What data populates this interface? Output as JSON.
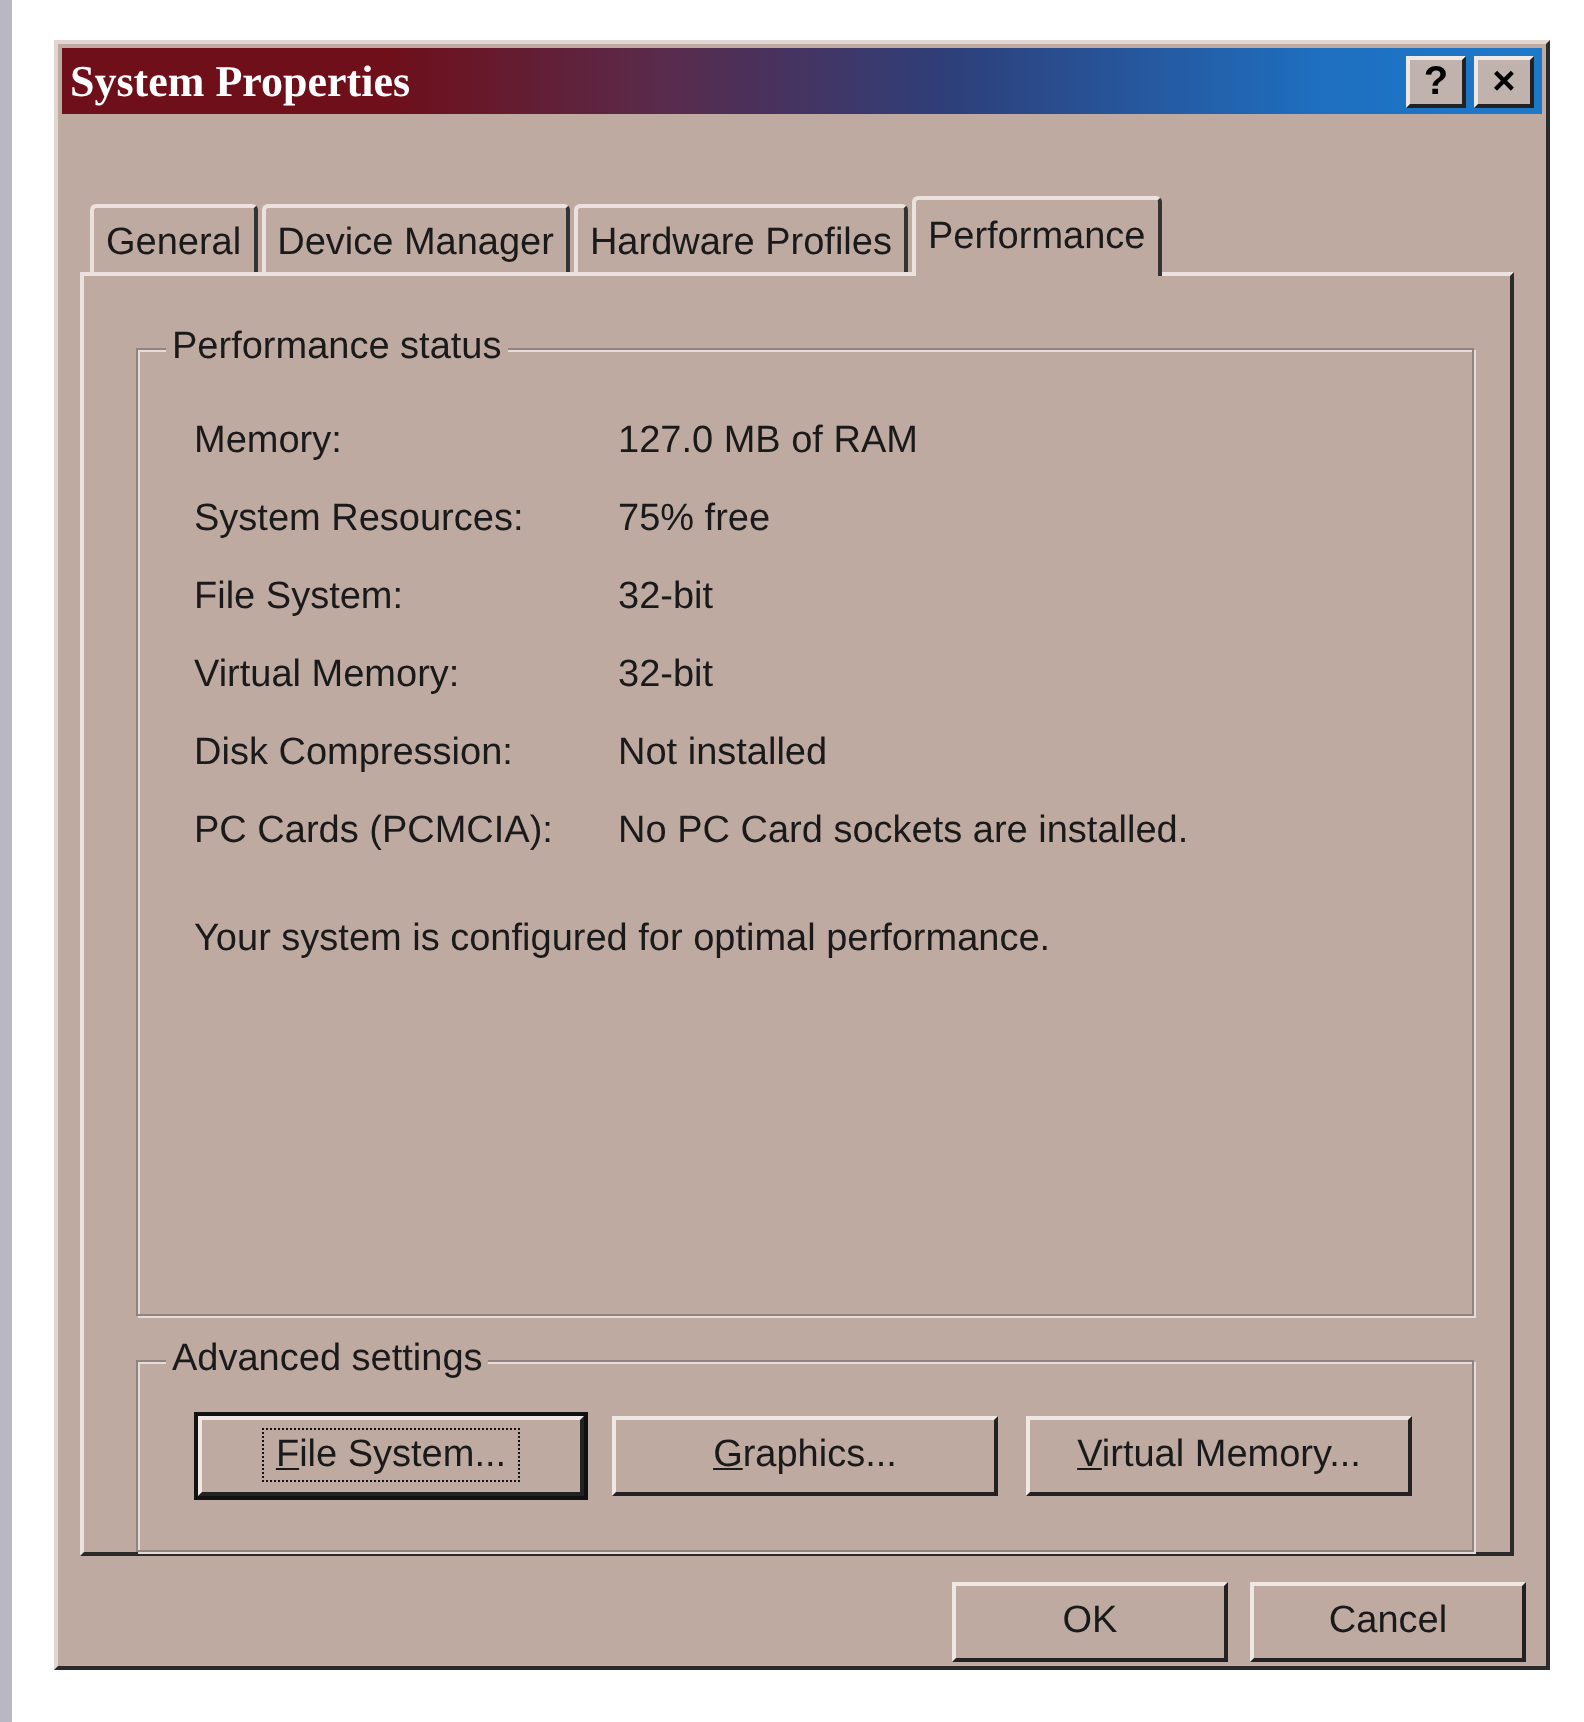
{
  "window": {
    "title": "System Properties",
    "title_buttons": [
      "?",
      "×"
    ]
  },
  "tabs": [
    {
      "label": "General",
      "selected": false
    },
    {
      "label": "Device Manager",
      "selected": false
    },
    {
      "label": "Hardware Profiles",
      "selected": false
    },
    {
      "label": "Performance",
      "selected": true
    }
  ],
  "performance_status": {
    "title": "Performance status",
    "rows": [
      {
        "label": "Memory:",
        "value": "127.0 MB of RAM"
      },
      {
        "label": "System Resources:",
        "value": "75% free"
      },
      {
        "label": "File System:",
        "value": "32-bit"
      },
      {
        "label": "Virtual Memory:",
        "value": "32-bit"
      },
      {
        "label": "Disk Compression:",
        "value": "Not installed"
      },
      {
        "label": "PC Cards (PCMCIA):",
        "value": "No PC Card sockets are installed."
      }
    ],
    "message": "Your system is configured for optimal performance."
  },
  "advanced_settings": {
    "title": "Advanced settings",
    "buttons": [
      {
        "label": "File System...",
        "focused": true,
        "first_letter_underlined": true
      },
      {
        "label": "Graphics...",
        "focused": false,
        "first_letter_underlined": true
      },
      {
        "label": "Virtual Memory...",
        "focused": false,
        "first_letter_underlined": true
      }
    ]
  },
  "buttons": [
    "OK",
    "Cancel"
  ]
}
